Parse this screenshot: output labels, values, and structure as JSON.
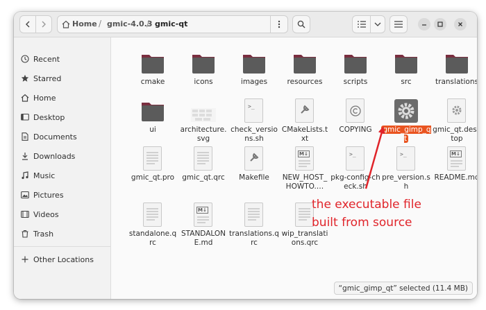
{
  "path": [
    "Home",
    "gmic-4.0.3",
    "gmic-qt"
  ],
  "sidebar": {
    "items": [
      {
        "label": "Recent",
        "icon": "clock-icon"
      },
      {
        "label": "Starred",
        "icon": "star-icon"
      },
      {
        "label": "Home",
        "icon": "home-icon"
      },
      {
        "label": "Desktop",
        "icon": "desktop-icon"
      },
      {
        "label": "Documents",
        "icon": "documents-icon"
      },
      {
        "label": "Downloads",
        "icon": "downloads-icon"
      },
      {
        "label": "Music",
        "icon": "music-icon"
      },
      {
        "label": "Pictures",
        "icon": "pictures-icon"
      },
      {
        "label": "Videos",
        "icon": "videos-icon"
      },
      {
        "label": "Trash",
        "icon": "trash-icon"
      }
    ],
    "other": "Other Locations"
  },
  "files": [
    {
      "name": "cmake",
      "type": "folder"
    },
    {
      "name": "icons",
      "type": "folder"
    },
    {
      "name": "images",
      "type": "folder"
    },
    {
      "name": "resources",
      "type": "folder"
    },
    {
      "name": "scripts",
      "type": "folder"
    },
    {
      "name": "src",
      "type": "folder"
    },
    {
      "name": "translations",
      "type": "folder"
    },
    {
      "name": "ui",
      "type": "folder"
    },
    {
      "name": "architecture.svg",
      "type": "image"
    },
    {
      "name": "check_versions.sh",
      "type": "script"
    },
    {
      "name": "CMakeLists.txt",
      "type": "make"
    },
    {
      "name": "COPYING",
      "type": "copying"
    },
    {
      "name": "gmic_gimp_qt",
      "type": "executable",
      "selected": true
    },
    {
      "name": "gmic_qt.desktop",
      "type": "desktop"
    },
    {
      "name": "gmic_qt.pro",
      "type": "text"
    },
    {
      "name": "gmic_qt.qrc",
      "type": "text"
    },
    {
      "name": "Makefile",
      "type": "make"
    },
    {
      "name": "NEW_HOST_HOWTO.…",
      "type": "markdown"
    },
    {
      "name": "pkg-config-check.sh",
      "type": "script"
    },
    {
      "name": "pre_version.sh",
      "type": "script"
    },
    {
      "name": "README.md",
      "type": "markdown"
    },
    {
      "name": "standalone.qrc",
      "type": "text"
    },
    {
      "name": "STANDALONE.md",
      "type": "markdown"
    },
    {
      "name": "translations.qrc",
      "type": "text"
    },
    {
      "name": "wip_translations.qrc",
      "type": "text"
    }
  ],
  "status": "“gmic_gimp_qt” selected  (11.4 MB)",
  "annotation": [
    "the executable file",
    "built from source"
  ],
  "colors": {
    "accent": "#e95420",
    "annotation": "#e0242a"
  }
}
